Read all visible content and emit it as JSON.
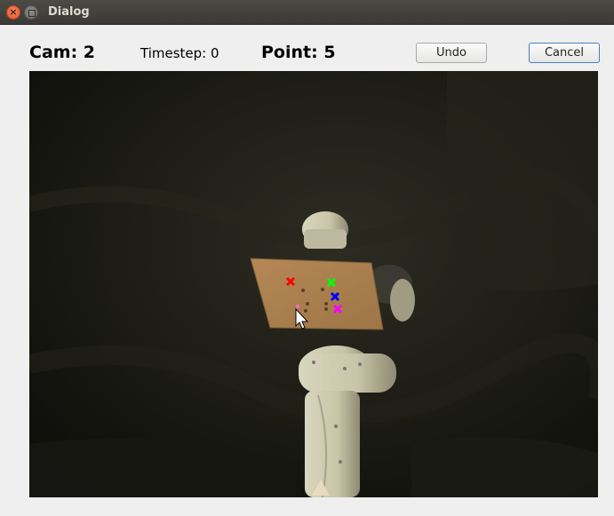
{
  "window": {
    "title": "Dialog"
  },
  "header": {
    "cam_label": "Cam: 2",
    "timestep_label": "Timestep: 0",
    "point_label": "Point: 5"
  },
  "buttons": {
    "undo_label": "Undo",
    "cancel_label": "Cancel"
  },
  "camera_view": {
    "markers": [
      {
        "color": "#ff0000",
        "shape": "x"
      },
      {
        "color": "#00ff00",
        "shape": "x"
      },
      {
        "color": "#0000ff",
        "shape": "x"
      },
      {
        "color": "#ff00ff",
        "shape": "x"
      },
      {
        "color": "#ff66cc",
        "shape": "dot"
      }
    ]
  },
  "colors": {
    "titlebar": "#3f3e3a",
    "dialog_bg": "#efefef",
    "cancel_border": "#4a7fbf"
  }
}
